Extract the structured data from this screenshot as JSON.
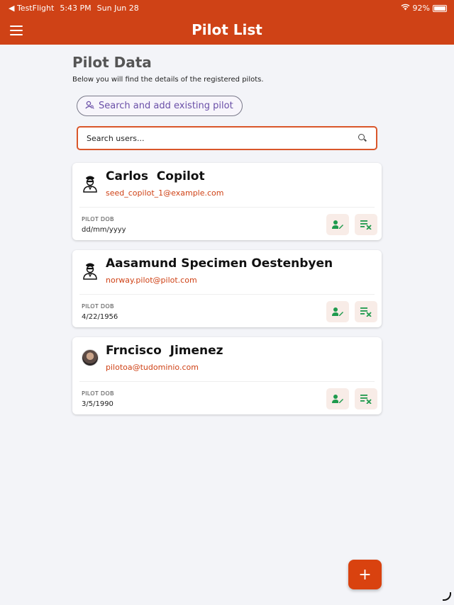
{
  "status_bar": {
    "back_app": "◀ TestFlight",
    "time": "5:43 PM",
    "date": "Sun Jun 28",
    "battery": "92%"
  },
  "app_bar": {
    "title": "Pilot List"
  },
  "page": {
    "title": "Pilot Data",
    "subtitle": "Below you will find the details of the registered pilots.",
    "add_existing_label": "Search and add existing pilot",
    "search_placeholder": "Search users..."
  },
  "pilots": [
    {
      "name": "Carlos  Copilot",
      "email": "seed_copilot_1@example.com",
      "dob_label": "PILOT DOB",
      "dob": "dd/mm/yyyy",
      "avatar": "pilot-icon"
    },
    {
      "name": "Aasamund Specimen Oestenbyen",
      "email": "norway.pilot@pilot.com",
      "dob_label": "PILOT DOB",
      "dob": "4/22/1956",
      "avatar": "pilot-icon"
    },
    {
      "name": "Frncisco  Jimenez",
      "email": "pilotoa@tudominio.com",
      "dob_label": "PILOT DOB",
      "dob": "3/5/1990",
      "avatar": "photo"
    }
  ],
  "fab": {
    "label": "+"
  },
  "colors": {
    "brand": "#cf4216",
    "action_green": "#1f9a4d"
  }
}
